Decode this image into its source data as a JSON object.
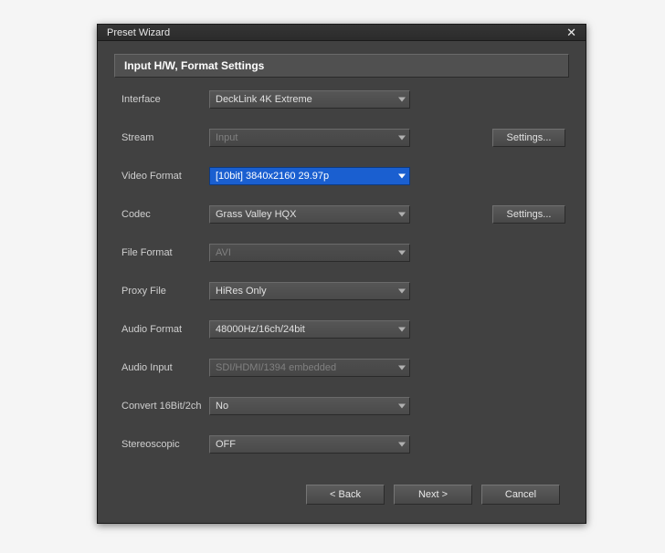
{
  "title": "Preset Wizard",
  "section_title": "Input H/W, Format Settings",
  "rows": {
    "interface": {
      "label": "Interface",
      "value": "DeckLink 4K Extreme",
      "enabled": true,
      "highlighted": false,
      "btn": null
    },
    "stream": {
      "label": "Stream",
      "value": "Input",
      "enabled": false,
      "highlighted": false,
      "btn": "Settings...",
      "btn_enabled": true
    },
    "videoformat": {
      "label": "Video Format",
      "value": "[10bit] 3840x2160 29.97p",
      "enabled": true,
      "highlighted": true,
      "btn": null
    },
    "codec": {
      "label": "Codec",
      "value": "Grass Valley HQX",
      "enabled": true,
      "highlighted": false,
      "btn": "Settings...",
      "btn_enabled": true
    },
    "fileformat": {
      "label": "File Format",
      "value": "AVI",
      "enabled": false,
      "highlighted": false,
      "btn": null
    },
    "proxyfile": {
      "label": "Proxy File",
      "value": "HiRes Only",
      "enabled": true,
      "highlighted": false,
      "btn": null
    },
    "audioformat": {
      "label": "Audio Format",
      "value": "48000Hz/16ch/24bit",
      "enabled": true,
      "highlighted": false,
      "btn": null
    },
    "audioinput": {
      "label": "Audio Input",
      "value": "SDI/HDMI/1394 embedded",
      "enabled": false,
      "highlighted": false,
      "btn": null
    },
    "convert": {
      "label": "Convert 16Bit/2ch",
      "value": "No",
      "enabled": true,
      "highlighted": false,
      "btn": null
    },
    "stereo": {
      "label": "Stereoscopic",
      "value": "OFF",
      "enabled": true,
      "highlighted": false,
      "btn": null
    }
  },
  "footer": {
    "back": "< Back",
    "next": "Next >",
    "cancel": "Cancel"
  }
}
